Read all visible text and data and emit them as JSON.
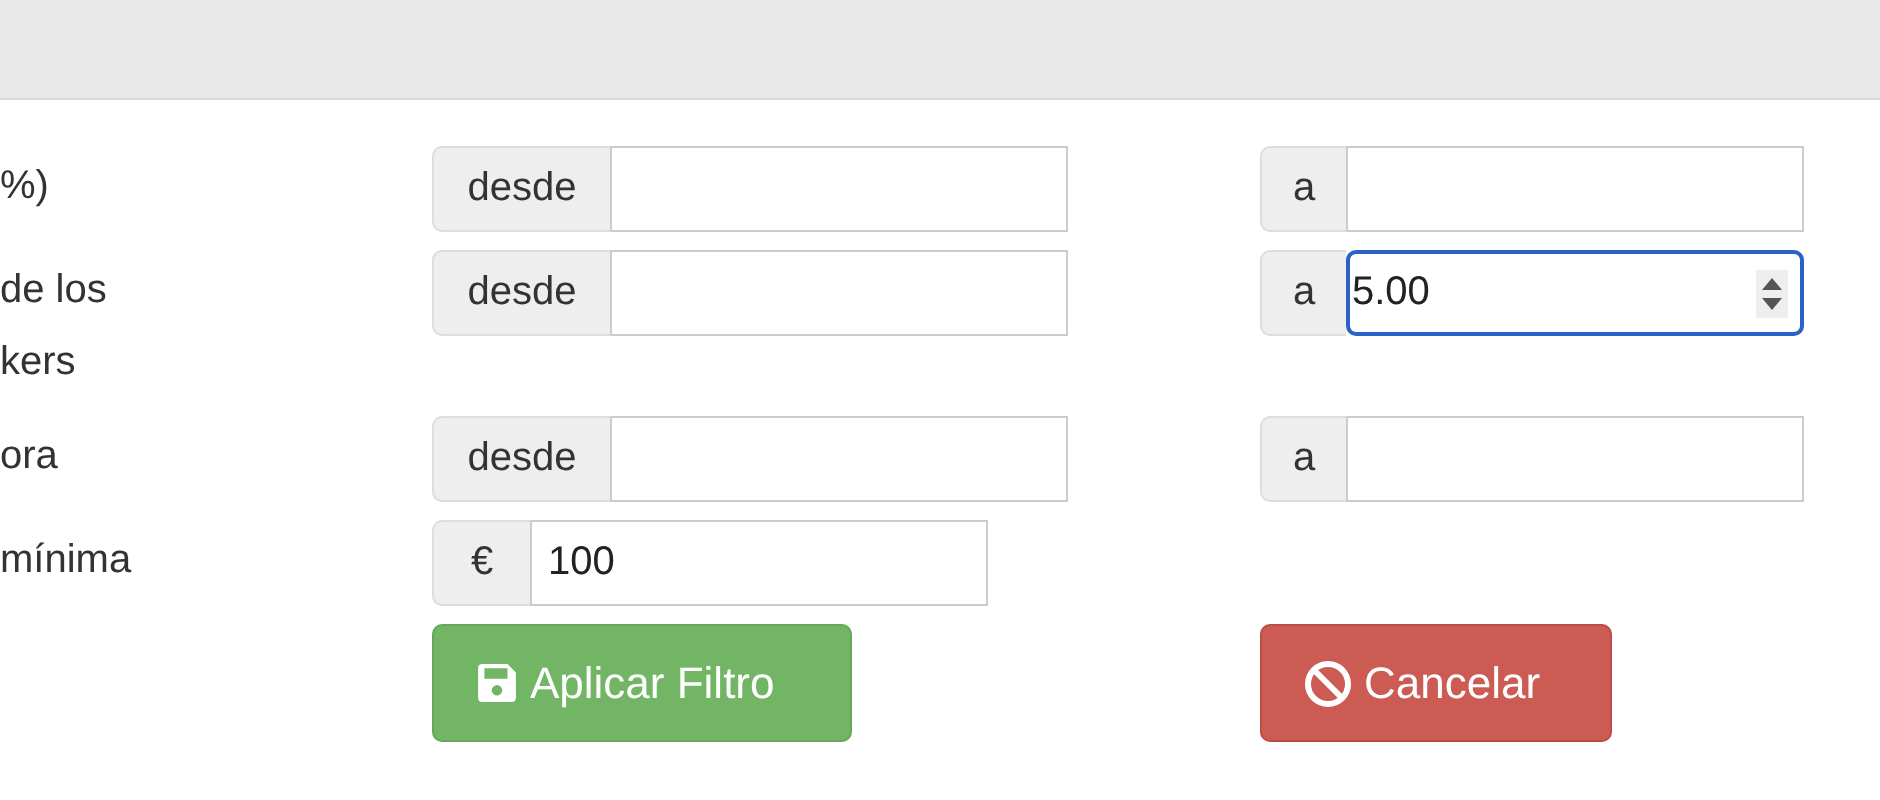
{
  "rows": [
    {
      "kind": "range",
      "label": [
        "%)"
      ],
      "from": {
        "addon": "desde",
        "focused": false
      },
      "to": {
        "addon": "a",
        "focused": false
      }
    },
    {
      "kind": "range",
      "label": [
        "de los",
        "kers"
      ],
      "from": {
        "addon": "desde",
        "focused": false
      },
      "to": {
        "addon": "a",
        "value": "5.00",
        "focused": true
      }
    },
    {
      "kind": "range",
      "label": [
        "ora"
      ],
      "from": {
        "addon": "desde",
        "focused": false
      },
      "to": {
        "addon": "a",
        "focused": false
      }
    },
    {
      "kind": "currency",
      "label": [
        "mínima"
      ],
      "field": {
        "addon": "€",
        "value": "100",
        "focused": false
      }
    }
  ],
  "buttons": [
    {
      "kind": "apply",
      "label": "Aplicar Filtro"
    },
    {
      "kind": "cancel",
      "label": "Cancelar"
    }
  ]
}
